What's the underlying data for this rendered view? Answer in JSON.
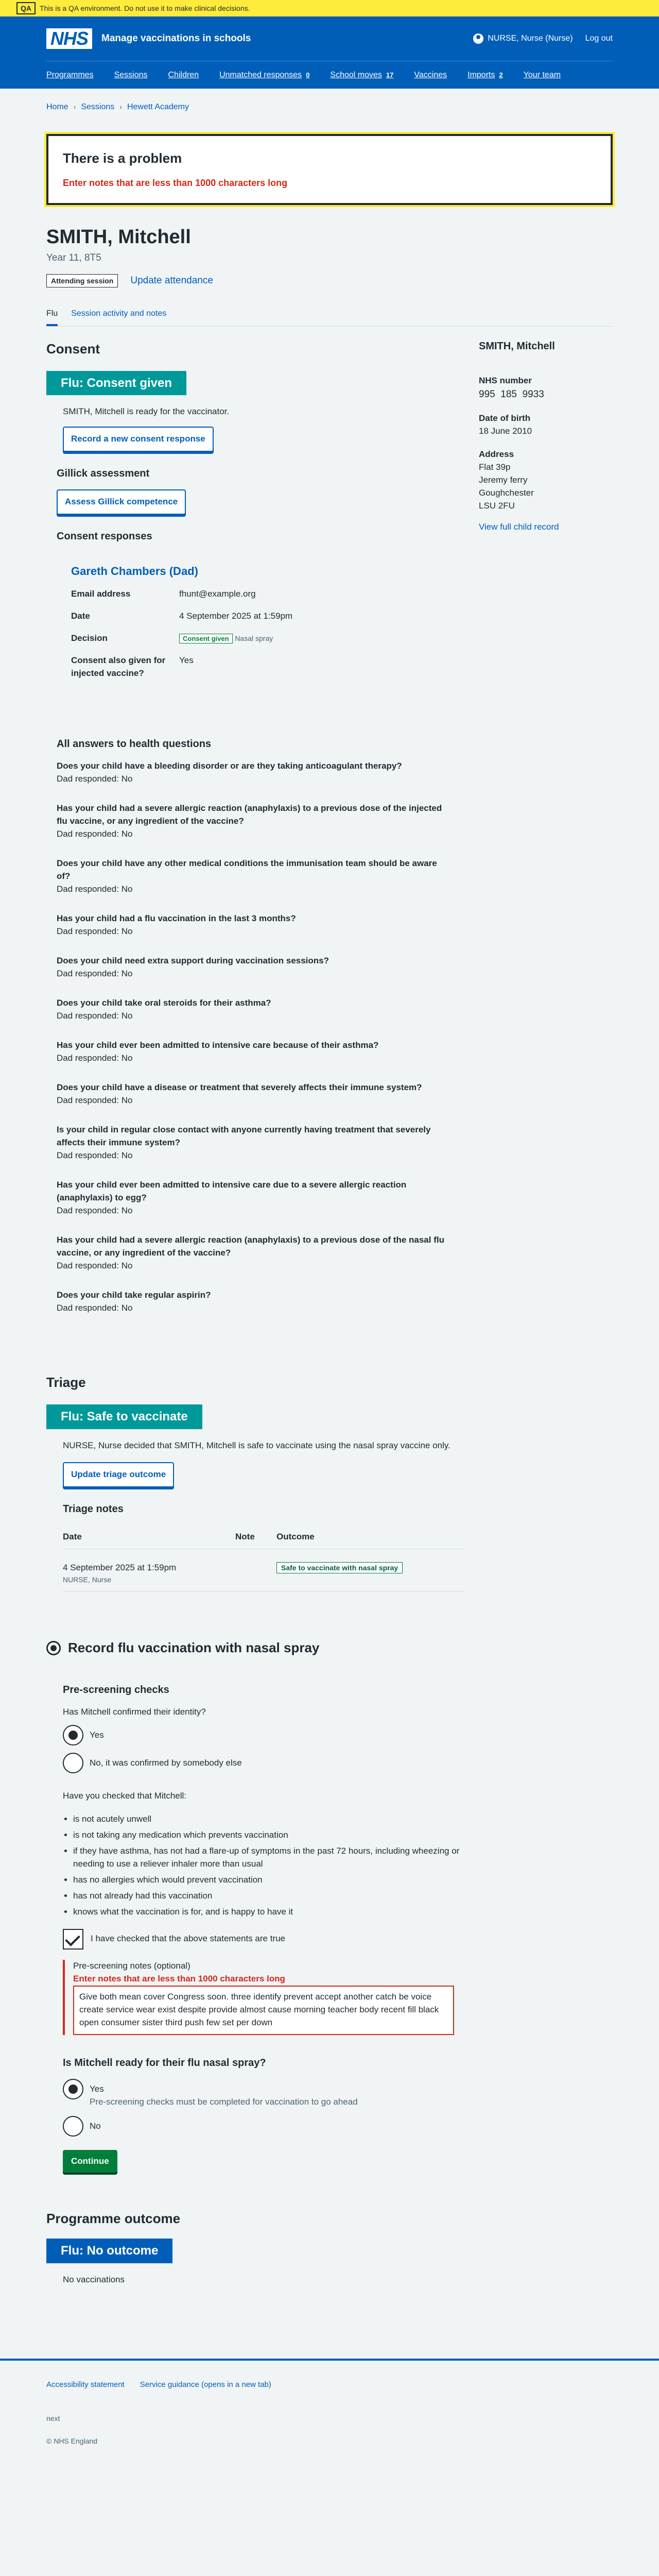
{
  "qa_banner": {
    "tag": "QA",
    "text": "This is a QA environment. Do not use it to make clinical decisions."
  },
  "header": {
    "logo": "NHS",
    "service": "Manage vaccinations in schools",
    "user": "NURSE, Nurse (Nurse)",
    "logout": "Log out",
    "nav": [
      {
        "label": "Programmes",
        "count": ""
      },
      {
        "label": "Sessions",
        "count": ""
      },
      {
        "label": "Children",
        "count": ""
      },
      {
        "label": "Unmatched responses",
        "count": "0"
      },
      {
        "label": "School moves",
        "count": "17"
      },
      {
        "label": "Vaccines",
        "count": ""
      },
      {
        "label": "Imports",
        "count": "2"
      },
      {
        "label": "Your team",
        "count": ""
      }
    ]
  },
  "breadcrumb": [
    "Home",
    "Sessions",
    "Hewett Academy"
  ],
  "error_summary": {
    "title": "There is a problem",
    "message": "Enter notes that are less than 1000 characters long"
  },
  "patient": {
    "name": "SMITH, Mitchell",
    "year": "Year 11, 8T5",
    "attending": "Attending session",
    "update_attendance": "Update attendance"
  },
  "tabs": [
    "Flu",
    "Session activity and notes"
  ],
  "consent": {
    "heading": "Consent",
    "banner": "Flu: Consent given",
    "ready_text": "SMITH, Mitchell is ready for the vaccinator.",
    "record_btn": "Record a new consent response",
    "gillick_heading": "Gillick assessment",
    "gillick_btn": "Assess Gillick competence",
    "responses_heading": "Consent responses",
    "parent": "Gareth Chambers (Dad)",
    "rows": [
      {
        "k": "Email address",
        "v": "fhunt@example.org"
      },
      {
        "k": "Date",
        "v": "4 September 2025 at 1:59pm"
      }
    ],
    "decision_label": "Decision",
    "decision_tag": "Consent given",
    "decision_method": "Nasal spray",
    "injected_label": "Consent also given for injected vaccine?",
    "injected_value": "Yes"
  },
  "sidebar": {
    "name": "SMITH, Mitchell",
    "nhs_label": "NHS number",
    "nhs_value": "995  185  9933",
    "dob_label": "Date of birth",
    "dob_value": "18 June 2010",
    "address_label": "Address",
    "address": [
      "Flat 39p",
      "Jeremy ferry",
      "Goughchester",
      "LSU 2FU"
    ],
    "record_link": "View full child record"
  },
  "health": {
    "heading": "All answers to health questions",
    "items": [
      {
        "q": "Does your child have a bleeding disorder or are they taking anticoagulant therapy?",
        "a": "Dad responded: No"
      },
      {
        "q": "Has your child had a severe allergic reaction (anaphylaxis) to a previous dose of the injected flu vaccine, or any ingredient of the vaccine?",
        "a": "Dad responded: No"
      },
      {
        "q": "Does your child have any other medical conditions the immunisation team should be aware of?",
        "a": "Dad responded: No"
      },
      {
        "q": "Has your child had a flu vaccination in the last 3 months?",
        "a": "Dad responded: No"
      },
      {
        "q": "Does your child need extra support during vaccination sessions?",
        "a": "Dad responded: No"
      },
      {
        "q": "Does your child take oral steroids for their asthma?",
        "a": "Dad responded: No"
      },
      {
        "q": "Has your child ever been admitted to intensive care because of their asthma?",
        "a": "Dad responded: No"
      },
      {
        "q": "Does your child have a disease or treatment that severely affects their immune system?",
        "a": "Dad responded: No"
      },
      {
        "q": "Is your child in regular close contact with anyone currently having treatment that severely affects their immune system?",
        "a": "Dad responded: No"
      },
      {
        "q": "Has your child ever been admitted to intensive care due to a severe allergic reaction (anaphylaxis) to egg?",
        "a": "Dad responded: No"
      },
      {
        "q": "Has your child had a severe allergic reaction (anaphylaxis) to a previous dose of the nasal flu vaccine, or any ingredient of the vaccine?",
        "a": "Dad responded: No"
      },
      {
        "q": "Does your child take regular aspirin?",
        "a": "Dad responded: No"
      }
    ]
  },
  "triage": {
    "heading": "Triage",
    "banner": "Flu: Safe to vaccinate",
    "text": "NURSE, Nurse decided that SMITH, Mitchell is safe to vaccinate using the nasal spray vaccine only.",
    "update_btn": "Update triage outcome",
    "notes_heading": "Triage notes",
    "cols": [
      "Date",
      "Note",
      "Outcome"
    ],
    "row_date": "4 September 2025 at 1:59pm",
    "row_by": "NURSE, Nurse",
    "row_outcome": "Safe to vaccinate with nasal spray"
  },
  "record": {
    "heading": "Record flu vaccination with nasal spray",
    "prescreen_heading": "Pre-screening checks",
    "identity_q": "Has Mitchell confirmed their identity?",
    "identity_yes": "Yes",
    "identity_no": "No, it was confirmed by somebody else",
    "checked_q": "Have you checked that Mitchell:",
    "checks": [
      "is not acutely unwell",
      "is not taking any medication which prevents vaccination",
      "if they have asthma, has not had a flare-up of symptoms in the past 72 hours, including wheezing or needing to use a reliever inhaler more than usual",
      "has no allergies which would prevent vaccination",
      "has not already had this vaccination",
      "knows what the vaccination is for, and is happy to have it"
    ],
    "confirm_label": "I have checked that the above statements are true",
    "notes_label": "Pre-screening notes (optional)",
    "notes_error": "Enter notes that are less than 1000 characters long",
    "notes_value": "Give both mean cover Congress soon. three identify prevent accept another catch be voice create service wear exist despite provide almost cause morning teacher body recent fill black open consumer sister third push few set per down",
    "ready_q": "Is Mitchell ready for their flu nasal spray?",
    "ready_yes": "Yes",
    "ready_hint": "Pre-screening checks must be completed for vaccination to go ahead",
    "ready_no": "No",
    "continue": "Continue"
  },
  "outcome": {
    "heading": "Programme outcome",
    "banner": "Flu: No outcome",
    "text": "No vaccinations"
  },
  "footer": {
    "links": [
      "Accessibility statement",
      "Service guidance (opens in a new tab)"
    ],
    "env": "next",
    "copyright": "© NHS England"
  },
  "colors": {
    "nhs_blue": "#005eb8",
    "teal": "#009999",
    "green": "#007f3b",
    "error": "#d5281b",
    "qa_yellow": "#ffeb3b"
  }
}
